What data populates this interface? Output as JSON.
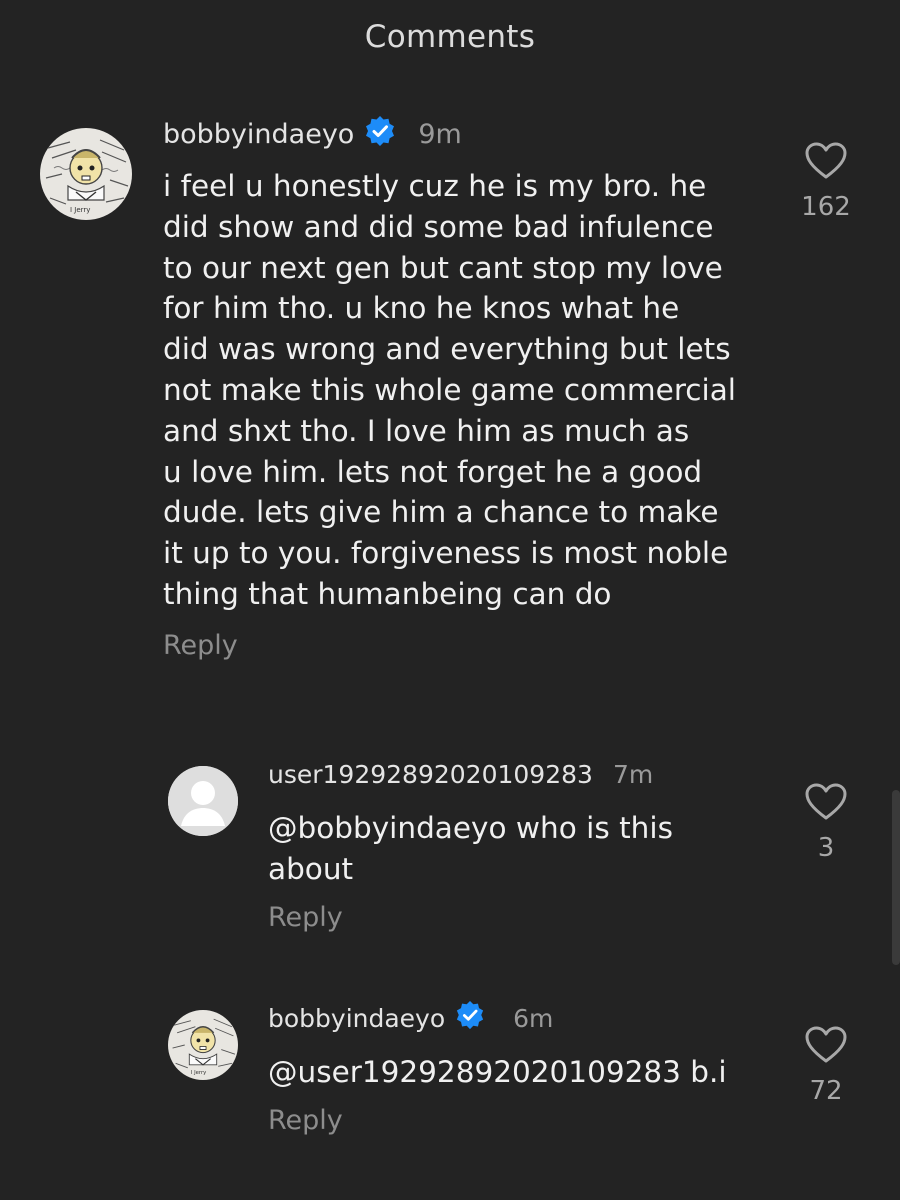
{
  "header": {
    "title": "Comments"
  },
  "comments": [
    {
      "username": "bobbyindaeyo",
      "verified": true,
      "time": "9m",
      "text": "i feel u honestly cuz he is my bro. he\ndid show and did some bad infulence\nto our next gen but cant stop my love\nfor him tho. u kno he knos what he\ndid was wrong and everything but lets\nnot make this whole game commercial\nand shxt tho. I love him as much as\nu love him. lets not forget he a good\ndude. lets give him a chance to make\nit up to you. forgiveness is most noble\nthing that humanbeing can do",
      "reply_label": "Reply",
      "likes": "162",
      "avatar": "sketch-avatar"
    },
    {
      "username": "user19292892020109283",
      "verified": false,
      "time": "7m",
      "mention": "@bobbyindaeyo",
      "text": " who is this\nabout",
      "reply_label": "Reply",
      "likes": "3",
      "avatar": "default-avatar"
    },
    {
      "username": "bobbyindaeyo",
      "verified": true,
      "time": "6m",
      "mention": "@user19292892020109283",
      "text": " b.i",
      "reply_label": "Reply",
      "likes": "72",
      "avatar": "sketch-avatar"
    }
  ],
  "colors": {
    "background": "#232323",
    "verified_badge": "#1d8cf8",
    "secondary_text": "#9a9a9a"
  }
}
